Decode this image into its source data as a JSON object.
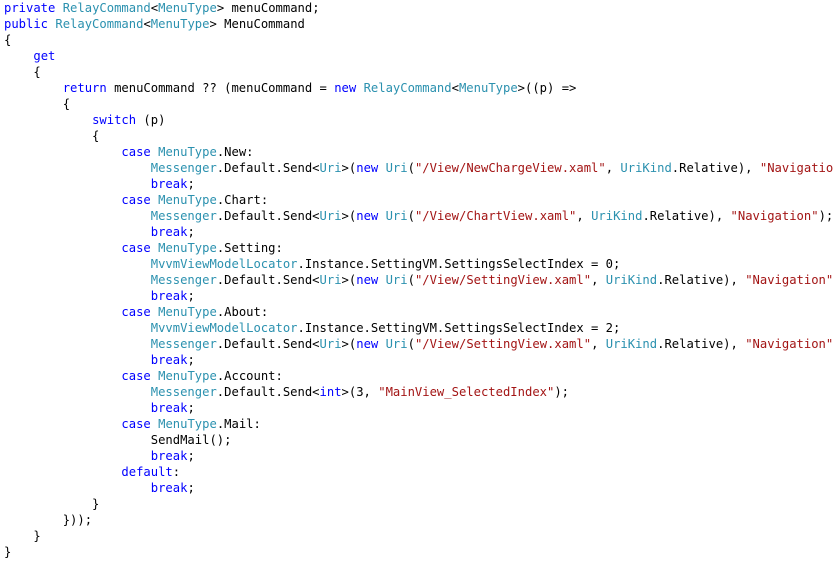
{
  "colors": {
    "keyword": "#0000ff",
    "type": "#2b91af",
    "string": "#a31515",
    "plain": "#000000",
    "background": "#ffffff"
  },
  "code_lines": [
    [
      {
        "t": "kw",
        "v": "private"
      },
      {
        "t": "pl",
        "v": " "
      },
      {
        "t": "ty",
        "v": "RelayCommand"
      },
      {
        "t": "pl",
        "v": "<"
      },
      {
        "t": "ty",
        "v": "MenuType"
      },
      {
        "t": "pl",
        "v": "> menuCommand;"
      }
    ],
    [
      {
        "t": "kw",
        "v": "public"
      },
      {
        "t": "pl",
        "v": " "
      },
      {
        "t": "ty",
        "v": "RelayCommand"
      },
      {
        "t": "pl",
        "v": "<"
      },
      {
        "t": "ty",
        "v": "MenuType"
      },
      {
        "t": "pl",
        "v": "> MenuCommand"
      }
    ],
    [
      {
        "t": "pl",
        "v": "{"
      }
    ],
    [
      {
        "t": "pl",
        "v": "    "
      },
      {
        "t": "kw",
        "v": "get"
      }
    ],
    [
      {
        "t": "pl",
        "v": "    {"
      }
    ],
    [
      {
        "t": "pl",
        "v": "        "
      },
      {
        "t": "kw",
        "v": "return"
      },
      {
        "t": "pl",
        "v": " menuCommand ?? (menuCommand = "
      },
      {
        "t": "kw",
        "v": "new"
      },
      {
        "t": "pl",
        "v": " "
      },
      {
        "t": "ty",
        "v": "RelayCommand"
      },
      {
        "t": "pl",
        "v": "<"
      },
      {
        "t": "ty",
        "v": "MenuType"
      },
      {
        "t": "pl",
        "v": ">((p) =>"
      }
    ],
    [
      {
        "t": "pl",
        "v": "        {"
      }
    ],
    [
      {
        "t": "pl",
        "v": "            "
      },
      {
        "t": "kw",
        "v": "switch"
      },
      {
        "t": "pl",
        "v": " (p)"
      }
    ],
    [
      {
        "t": "pl",
        "v": "            {"
      }
    ],
    [
      {
        "t": "pl",
        "v": "                "
      },
      {
        "t": "kw",
        "v": "case"
      },
      {
        "t": "pl",
        "v": " "
      },
      {
        "t": "ty",
        "v": "MenuType"
      },
      {
        "t": "pl",
        "v": ".New:"
      }
    ],
    [
      {
        "t": "pl",
        "v": "                    "
      },
      {
        "t": "ty",
        "v": "Messenger"
      },
      {
        "t": "pl",
        "v": ".Default.Send<"
      },
      {
        "t": "ty",
        "v": "Uri"
      },
      {
        "t": "pl",
        "v": ">("
      },
      {
        "t": "kw",
        "v": "new"
      },
      {
        "t": "pl",
        "v": " "
      },
      {
        "t": "ty",
        "v": "Uri"
      },
      {
        "t": "pl",
        "v": "("
      },
      {
        "t": "st",
        "v": "\"/View/NewChargeView.xaml\""
      },
      {
        "t": "pl",
        "v": ", "
      },
      {
        "t": "ty",
        "v": "UriKind"
      },
      {
        "t": "pl",
        "v": ".Relative), "
      },
      {
        "t": "st",
        "v": "\"Navigation\""
      },
      {
        "t": "pl",
        "v": ");"
      }
    ],
    [
      {
        "t": "pl",
        "v": "                    "
      },
      {
        "t": "kw",
        "v": "break"
      },
      {
        "t": "pl",
        "v": ";"
      }
    ],
    [
      {
        "t": "pl",
        "v": "                "
      },
      {
        "t": "kw",
        "v": "case"
      },
      {
        "t": "pl",
        "v": " "
      },
      {
        "t": "ty",
        "v": "MenuType"
      },
      {
        "t": "pl",
        "v": ".Chart:"
      }
    ],
    [
      {
        "t": "pl",
        "v": "                    "
      },
      {
        "t": "ty",
        "v": "Messenger"
      },
      {
        "t": "pl",
        "v": ".Default.Send<"
      },
      {
        "t": "ty",
        "v": "Uri"
      },
      {
        "t": "pl",
        "v": ">("
      },
      {
        "t": "kw",
        "v": "new"
      },
      {
        "t": "pl",
        "v": " "
      },
      {
        "t": "ty",
        "v": "Uri"
      },
      {
        "t": "pl",
        "v": "("
      },
      {
        "t": "st",
        "v": "\"/View/ChartView.xaml\""
      },
      {
        "t": "pl",
        "v": ", "
      },
      {
        "t": "ty",
        "v": "UriKind"
      },
      {
        "t": "pl",
        "v": ".Relative), "
      },
      {
        "t": "st",
        "v": "\"Navigation\""
      },
      {
        "t": "pl",
        "v": ");"
      }
    ],
    [
      {
        "t": "pl",
        "v": "                    "
      },
      {
        "t": "kw",
        "v": "break"
      },
      {
        "t": "pl",
        "v": ";"
      }
    ],
    [
      {
        "t": "pl",
        "v": "                "
      },
      {
        "t": "kw",
        "v": "case"
      },
      {
        "t": "pl",
        "v": " "
      },
      {
        "t": "ty",
        "v": "MenuType"
      },
      {
        "t": "pl",
        "v": ".Setting:"
      }
    ],
    [
      {
        "t": "pl",
        "v": "                    "
      },
      {
        "t": "ty",
        "v": "MvvmViewModelLocator"
      },
      {
        "t": "pl",
        "v": ".Instance.SettingVM.SettingsSelectIndex = 0;"
      }
    ],
    [
      {
        "t": "pl",
        "v": "                    "
      },
      {
        "t": "ty",
        "v": "Messenger"
      },
      {
        "t": "pl",
        "v": ".Default.Send<"
      },
      {
        "t": "ty",
        "v": "Uri"
      },
      {
        "t": "pl",
        "v": ">("
      },
      {
        "t": "kw",
        "v": "new"
      },
      {
        "t": "pl",
        "v": " "
      },
      {
        "t": "ty",
        "v": "Uri"
      },
      {
        "t": "pl",
        "v": "("
      },
      {
        "t": "st",
        "v": "\"/View/SettingView.xaml\""
      },
      {
        "t": "pl",
        "v": ", "
      },
      {
        "t": "ty",
        "v": "UriKind"
      },
      {
        "t": "pl",
        "v": ".Relative), "
      },
      {
        "t": "st",
        "v": "\"Navigation\""
      },
      {
        "t": "pl",
        "v": ");"
      }
    ],
    [
      {
        "t": "pl",
        "v": "                    "
      },
      {
        "t": "kw",
        "v": "break"
      },
      {
        "t": "pl",
        "v": ";"
      }
    ],
    [
      {
        "t": "pl",
        "v": "                "
      },
      {
        "t": "kw",
        "v": "case"
      },
      {
        "t": "pl",
        "v": " "
      },
      {
        "t": "ty",
        "v": "MenuType"
      },
      {
        "t": "pl",
        "v": ".About:"
      }
    ],
    [
      {
        "t": "pl",
        "v": "                    "
      },
      {
        "t": "ty",
        "v": "MvvmViewModelLocator"
      },
      {
        "t": "pl",
        "v": ".Instance.SettingVM.SettingsSelectIndex = 2;"
      }
    ],
    [
      {
        "t": "pl",
        "v": "                    "
      },
      {
        "t": "ty",
        "v": "Messenger"
      },
      {
        "t": "pl",
        "v": ".Default.Send<"
      },
      {
        "t": "ty",
        "v": "Uri"
      },
      {
        "t": "pl",
        "v": ">("
      },
      {
        "t": "kw",
        "v": "new"
      },
      {
        "t": "pl",
        "v": " "
      },
      {
        "t": "ty",
        "v": "Uri"
      },
      {
        "t": "pl",
        "v": "("
      },
      {
        "t": "st",
        "v": "\"/View/SettingView.xaml\""
      },
      {
        "t": "pl",
        "v": ", "
      },
      {
        "t": "ty",
        "v": "UriKind"
      },
      {
        "t": "pl",
        "v": ".Relative), "
      },
      {
        "t": "st",
        "v": "\"Navigation\""
      },
      {
        "t": "pl",
        "v": ");"
      }
    ],
    [
      {
        "t": "pl",
        "v": "                    "
      },
      {
        "t": "kw",
        "v": "break"
      },
      {
        "t": "pl",
        "v": ";"
      }
    ],
    [
      {
        "t": "pl",
        "v": "                "
      },
      {
        "t": "kw",
        "v": "case"
      },
      {
        "t": "pl",
        "v": " "
      },
      {
        "t": "ty",
        "v": "MenuType"
      },
      {
        "t": "pl",
        "v": ".Account:"
      }
    ],
    [
      {
        "t": "pl",
        "v": "                    "
      },
      {
        "t": "ty",
        "v": "Messenger"
      },
      {
        "t": "pl",
        "v": ".Default.Send<"
      },
      {
        "t": "kw",
        "v": "int"
      },
      {
        "t": "pl",
        "v": ">(3, "
      },
      {
        "t": "st",
        "v": "\"MainView_SelectedIndex\""
      },
      {
        "t": "pl",
        "v": ");"
      }
    ],
    [
      {
        "t": "pl",
        "v": "                    "
      },
      {
        "t": "kw",
        "v": "break"
      },
      {
        "t": "pl",
        "v": ";"
      }
    ],
    [
      {
        "t": "pl",
        "v": "                "
      },
      {
        "t": "kw",
        "v": "case"
      },
      {
        "t": "pl",
        "v": " "
      },
      {
        "t": "ty",
        "v": "MenuType"
      },
      {
        "t": "pl",
        "v": ".Mail:"
      }
    ],
    [
      {
        "t": "pl",
        "v": "                    SendMail();"
      }
    ],
    [
      {
        "t": "pl",
        "v": "                    "
      },
      {
        "t": "kw",
        "v": "break"
      },
      {
        "t": "pl",
        "v": ";"
      }
    ],
    [
      {
        "t": "pl",
        "v": "                "
      },
      {
        "t": "kw",
        "v": "default"
      },
      {
        "t": "pl",
        "v": ":"
      }
    ],
    [
      {
        "t": "pl",
        "v": "                    "
      },
      {
        "t": "kw",
        "v": "break"
      },
      {
        "t": "pl",
        "v": ";"
      }
    ],
    [
      {
        "t": "pl",
        "v": "            }"
      }
    ],
    [
      {
        "t": "pl",
        "v": "        }));"
      }
    ],
    [
      {
        "t": "pl",
        "v": "    }"
      }
    ],
    [
      {
        "t": "pl",
        "v": "}"
      }
    ]
  ]
}
